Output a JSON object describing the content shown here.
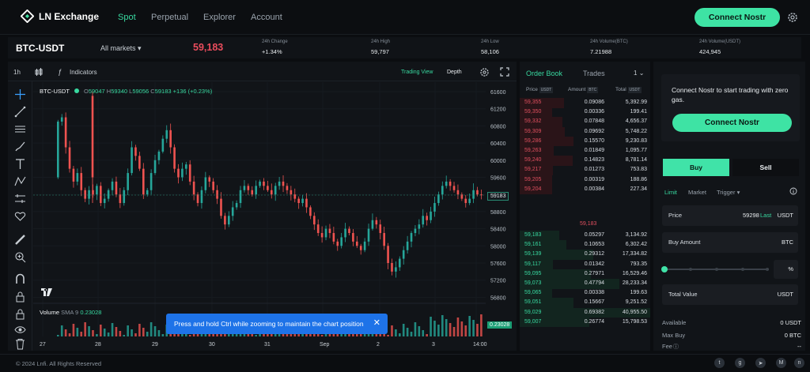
{
  "nav": {
    "brand": "LN Exchange",
    "links": [
      "Spot",
      "Perpetual",
      "Explorer",
      "Account"
    ],
    "active": "Spot",
    "connect_label": "Connect Nostr"
  },
  "ticker": {
    "pair": "BTC-USDT",
    "all_markets": "All markets",
    "last_price": "59,183",
    "stats": [
      {
        "label": "24h Change",
        "value": "+1.34%"
      },
      {
        "label": "24h High",
        "value": "59,797"
      },
      {
        "label": "24h Low",
        "value": "58,106"
      },
      {
        "label": "24h Volume(BTC)",
        "value": "7.21988"
      },
      {
        "label": "24h Volume(USDT)",
        "value": "424,945"
      }
    ]
  },
  "chart": {
    "interval": "1h",
    "indicators_label": "Indicators",
    "view_trading": "Trading View",
    "view_depth": "Depth",
    "symbol": "BTC-USDT",
    "ohlc": {
      "o_label": "O",
      "o": "59047",
      "h_label": "H",
      "h": "59340",
      "l_label": "L",
      "l": "59056",
      "c_label": "C",
      "c": "59183",
      "change": "+136 (+0.23%)"
    },
    "price_axis": [
      "61600",
      "61200",
      "60800",
      "60400",
      "60000",
      "59600",
      "59200",
      "58800",
      "58400",
      "58000",
      "57600",
      "57200",
      "56800"
    ],
    "last_tag": "59183",
    "volume_legend": {
      "label": "Volume",
      "sma": "SMA 9",
      "value": "0.23028"
    },
    "volume_tag": "0.23028",
    "time_axis": [
      "27",
      "28",
      "29",
      "30",
      "31",
      "Sep",
      "2",
      "3",
      "14:00"
    ],
    "toast": "Press and hold Ctrl while zooming to maintain the chart position",
    "colors": {
      "up": "#26a69a",
      "down": "#ef5350"
    }
  },
  "orderbook": {
    "tabs": [
      "Order Book",
      "Trades"
    ],
    "precision": "1",
    "headers": {
      "price": "Price",
      "price_unit": "USDT",
      "amount": "Amount",
      "amount_unit": "BTC",
      "total": "Total",
      "total_unit": "USDT"
    },
    "asks": [
      {
        "price": "59,355",
        "amount": "0.09086",
        "total": "5,392.99"
      },
      {
        "price": "59,350",
        "amount": "0.00336",
        "total": "199.41"
      },
      {
        "price": "59,332",
        "amount": "0.07848",
        "total": "4,656.37"
      },
      {
        "price": "59,309",
        "amount": "0.09692",
        "total": "5,748.22"
      },
      {
        "price": "59,286",
        "amount": "0.15570",
        "total": "9,230.83"
      },
      {
        "price": "59,263",
        "amount": "0.01849",
        "total": "1,095.77"
      },
      {
        "price": "59,240",
        "amount": "0.14823",
        "total": "8,781.14"
      },
      {
        "price": "59,217",
        "amount": "0.01273",
        "total": "753.83"
      },
      {
        "price": "59,205",
        "amount": "0.00319",
        "total": "188.86"
      },
      {
        "price": "59,204",
        "amount": "0.00384",
        "total": "227.34"
      }
    ],
    "mid_price": "59,183",
    "bids": [
      {
        "price": "59,183",
        "amount": "0.05297",
        "total": "3,134.92"
      },
      {
        "price": "59,161",
        "amount": "0.10653",
        "total": "6,302.42"
      },
      {
        "price": "59,139",
        "amount": "0.29312",
        "total": "17,334.82"
      },
      {
        "price": "59,117",
        "amount": "0.01342",
        "total": "793.35"
      },
      {
        "price": "59,095",
        "amount": "0.27971",
        "total": "16,529.46"
      },
      {
        "price": "59,073",
        "amount": "0.47794",
        "total": "28,233.34"
      },
      {
        "price": "59,065",
        "amount": "0.00338",
        "total": "199.63"
      },
      {
        "price": "59,051",
        "amount": "0.15667",
        "total": "9,251.52"
      },
      {
        "price": "59,029",
        "amount": "0.69382",
        "total": "40,955.50"
      },
      {
        "price": "59,007",
        "amount": "0.26774",
        "total": "15,798.53"
      }
    ]
  },
  "trade": {
    "promo": "Connect Nostr to start trading with zero gas.",
    "connect_label": "Connect Nostr",
    "tabs": {
      "buy": "Buy",
      "sell": "Sell"
    },
    "order_types": [
      "Limit",
      "Market",
      "Trigger"
    ],
    "price": {
      "label": "Price",
      "value": "59298",
      "last": "Last",
      "unit": "USDT"
    },
    "amount": {
      "label": "Buy Amount",
      "unit": "BTC"
    },
    "slider_unit": "%",
    "total": {
      "label": "Total Value",
      "unit": "USDT"
    },
    "summary": [
      {
        "label": "Available",
        "value": "0 USDT"
      },
      {
        "label": "Max Buy",
        "value": "0 BTC"
      },
      {
        "label": "Fee",
        "value": "--"
      }
    ]
  },
  "footer": {
    "copyright": "© 2024 Lnfi. All Rights Reserved",
    "social": [
      "twitter-icon",
      "github-icon",
      "discord-icon",
      "telegram-icon",
      "medium-icon",
      "nostr-icon"
    ]
  }
}
